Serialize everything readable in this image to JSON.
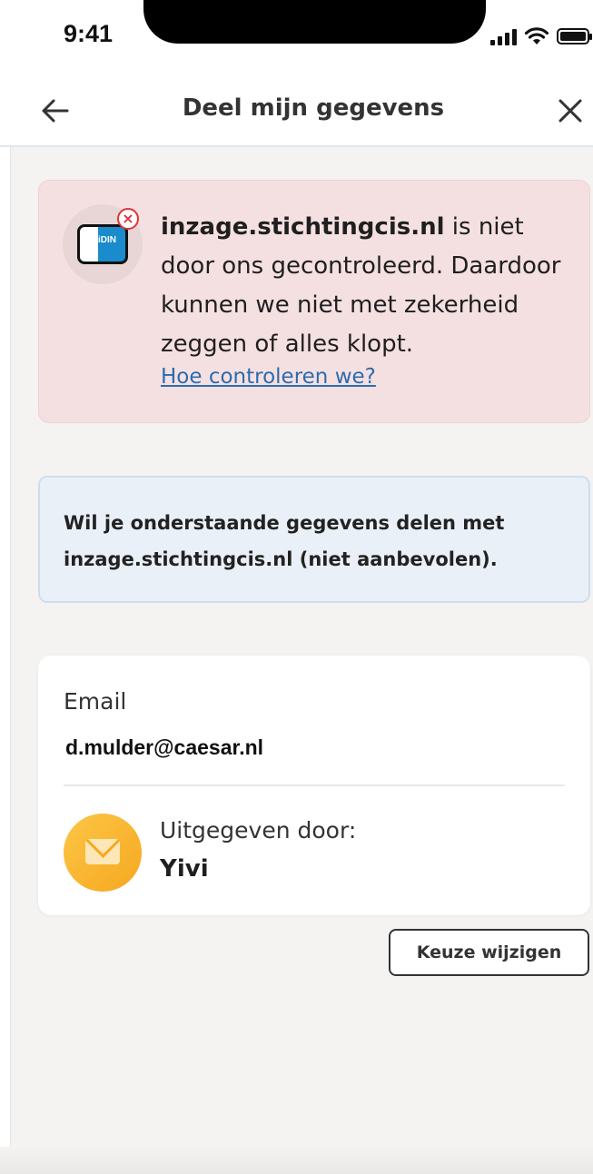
{
  "status_bar": {
    "time": "9:41"
  },
  "header": {
    "title": "Deel mijn gegevens"
  },
  "warning": {
    "domain": "inzage.stichtingcis.nl",
    "message_rest": " is niet door ons gecontroleerd. Daardoor kunnen we niet met zekerheid zeggen of alles klopt.",
    "link": "Hoe controleren we?",
    "logo_text": "iDIN",
    "accent_color": "#e0323a"
  },
  "info": {
    "text": "Wil je onderstaande gegevens delen met inzage.stichtingcis.nl (niet aanbevolen)."
  },
  "credential": {
    "label": "Email",
    "value": "d.mulder@caesar.nl",
    "issuer_label": "Uitgegeven door:",
    "issuer_name": "Yivi",
    "icon": "mail-icon"
  },
  "actions": {
    "change_label": "Keuze wijzigen"
  }
}
